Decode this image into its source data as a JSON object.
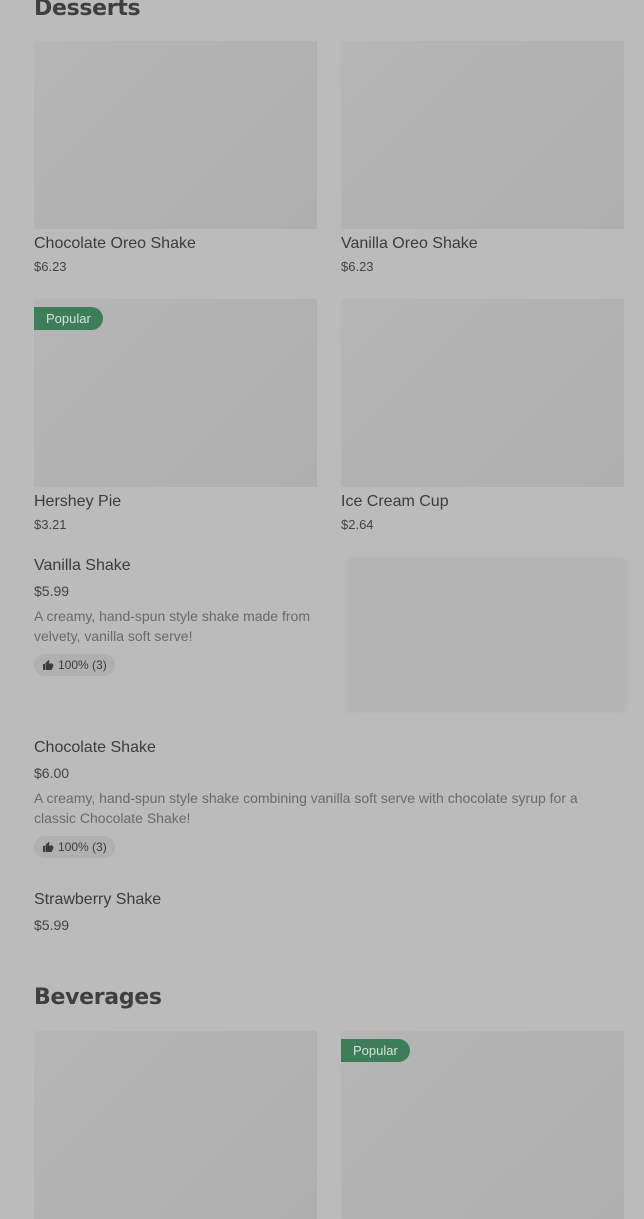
{
  "sections": {
    "desserts_title": "Desserts",
    "beverages_title": "Beverages"
  },
  "desserts_grid": [
    {
      "name": "Chocolate Oreo Shake",
      "price": "$6.23"
    },
    {
      "name": "Vanilla Oreo Shake",
      "price": "$6.23"
    },
    {
      "name": "Hershey Pie",
      "price": "$3.21",
      "badge": "Popular"
    },
    {
      "name": "Ice Cream Cup",
      "price": "$2.64"
    }
  ],
  "desserts_list": [
    {
      "name": "Vanilla Shake",
      "price": "$5.99",
      "description": "A creamy, hand-spun style shake made from velvety, vanilla soft serve!",
      "rating": "100% (3)"
    },
    {
      "name": "Chocolate Shake",
      "price": "$6.00",
      "description": "A creamy, hand-spun style shake combining vanilla soft serve with chocolate syrup for a classic Chocolate Shake!",
      "rating": "100% (3)"
    },
    {
      "name": "Strawberry Shake",
      "price": "$5.99"
    }
  ],
  "beverages_grid": [
    {
      "name": "",
      "price": ""
    },
    {
      "name": "",
      "price": "",
      "badge": "Popular"
    }
  ],
  "icons": {
    "rating": "thumbs-up-icon"
  },
  "colors": {
    "background": "#bbbbbb",
    "badge": "#3e7d5a",
    "placeholder": "#b3b3b3"
  }
}
